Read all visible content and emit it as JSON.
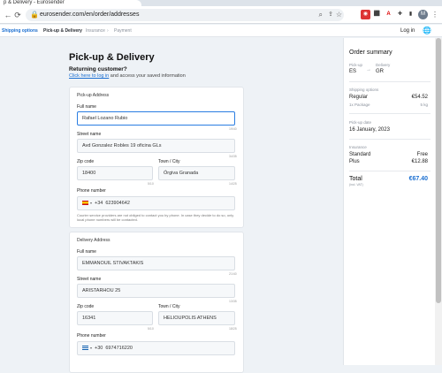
{
  "browser": {
    "tab_title": "p & Delivery - Eurosender",
    "url": "eurosender.com/en/order/addresses",
    "avatar_letter": "M"
  },
  "steps": [
    {
      "label": "Shipping options",
      "state": "active"
    },
    {
      "label": "Pick-up & Delivery",
      "state": "done"
    },
    {
      "label": "Insurance",
      "state": "todo"
    },
    {
      "label": "Payment",
      "state": "todo"
    }
  ],
  "header": {
    "login": "Log in"
  },
  "page": {
    "title": "Pick-up & Delivery",
    "returning_title": "Returning customer?",
    "login_link": "Click here to log in",
    "login_suffix": " and access your saved information"
  },
  "pickup": {
    "title": "Pick-up Address",
    "full_name_label": "Full name",
    "full_name": "Rafael Lozano Rubio",
    "full_name_count": "19/40",
    "street_label": "Street name",
    "street": "Avd Gonzalez Robles 19 oficina GLs",
    "street_count": "34/35",
    "zip_label": "Zip code",
    "zip": "18400",
    "zip_count": "5/10",
    "city_label": "Town / City",
    "city": "Órgiva Granada",
    "city_count": "14/25",
    "phone_label": "Phone number",
    "phone_code": "+34",
    "phone": "623904642",
    "note": "Courier service providers are not obliged to contact you by phone. In case they decide to do so, only local phone numbers will be contacted."
  },
  "delivery": {
    "title": "Delivery Address",
    "full_name_label": "Full name",
    "full_name": "EMMANOUIL STIVAKTAKIS",
    "full_name_count": "21/40",
    "street_label": "Street name",
    "street": "ARISTARHOU 25",
    "street_count": "13/35",
    "zip_label": "Zip code",
    "zip": "16341",
    "zip_count": "5/10",
    "city_label": "Town / City",
    "city": "HELIOUPOLIS ATHENS",
    "city_count": "18/25",
    "phone_label": "Phone number",
    "phone_code": "+30",
    "phone": "6974716220"
  },
  "summary": {
    "title": "Order summary",
    "pickup_label": "Pick-up",
    "pickup_country": "ES",
    "delivery_label": "Delivery",
    "delivery_country": "GR",
    "shipping_label": "Shipping options",
    "shipping_name": "Regular",
    "shipping_price": "€54.52",
    "package_label": "1x Package",
    "package_weight": "5 kg",
    "pickup_date_label": "Pick-up date",
    "pickup_date": "16 January, 2023",
    "insurance_label": "Insurance",
    "ins_standard": "Standard",
    "ins_standard_price": "Free",
    "ins_plus": "Plus",
    "ins_plus_price": "€12.88",
    "total_label": "Total",
    "total_sub": "(incl. VAT)",
    "total_value": "€67.40"
  },
  "colors": {
    "accent": "#1b6fd1",
    "background": "#eef2f6"
  }
}
